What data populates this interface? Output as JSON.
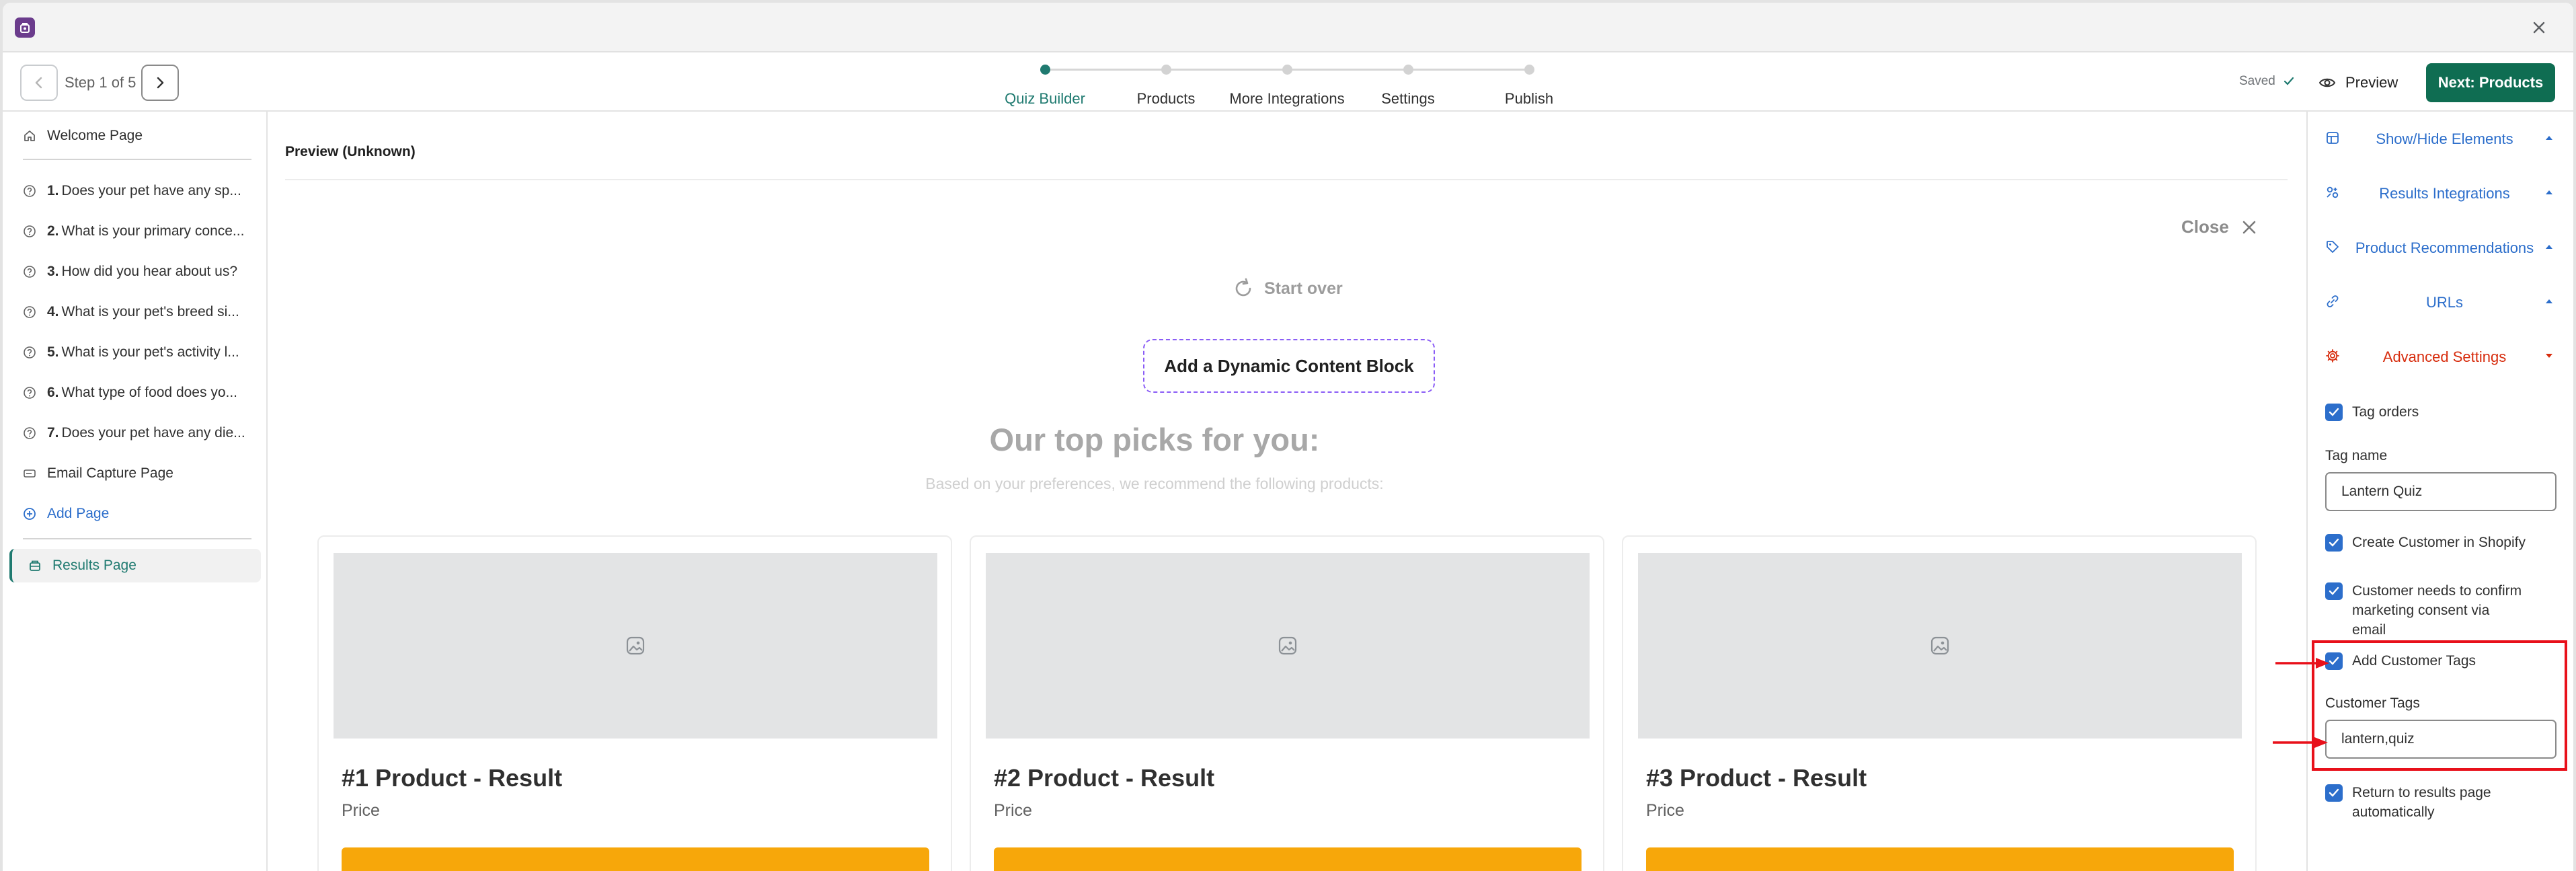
{
  "header": {
    "step_count": "Step 1 of 5",
    "steps": [
      {
        "label": "Quiz Builder",
        "active": true
      },
      {
        "label": "Products",
        "active": false
      },
      {
        "label": "More Integrations",
        "active": false
      },
      {
        "label": "Settings",
        "active": false
      },
      {
        "label": "Publish",
        "active": false
      }
    ],
    "saved": "Saved",
    "preview": "Preview",
    "next": "Next: Products"
  },
  "sidebar": {
    "welcome": "Welcome Page",
    "questions": [
      {
        "num": "1.",
        "text": "Does your pet have any sp..."
      },
      {
        "num": "2.",
        "text": "What is your primary conce..."
      },
      {
        "num": "3.",
        "text": "How did you hear about us?"
      },
      {
        "num": "4.",
        "text": "What is your pet's breed si..."
      },
      {
        "num": "5.",
        "text": "What is your pet's activity l..."
      },
      {
        "num": "6.",
        "text": "What type of food does yo..."
      },
      {
        "num": "7.",
        "text": "Does your pet have any die..."
      }
    ],
    "email_capture": "Email Capture Page",
    "add_page": "Add Page",
    "results": "Results Page"
  },
  "preview": {
    "title": "Preview (Unknown)",
    "close": "Close",
    "start_over": "Start over",
    "dynamic_block": "Add a Dynamic Content Block",
    "heading": "Our top picks for you:",
    "subheading": "Based on your preferences, we recommend the following products:",
    "products": [
      {
        "title": "#1 Product - Result",
        "price": "Price"
      },
      {
        "title": "#2 Product - Result",
        "price": "Price"
      },
      {
        "title": "#3 Product - Result",
        "price": "Price"
      }
    ]
  },
  "panel": {
    "sections": {
      "show_hide": "Show/Hide Elements",
      "results_integrations": "Results Integrations",
      "product_recommendations": "Product Recommendations",
      "urls": "URLs",
      "advanced": "Advanced Settings"
    },
    "tag_orders": "Tag orders",
    "tag_name_label": "Tag name",
    "tag_name_value": "Lantern Quiz",
    "create_customer": "Create Customer in Shopify",
    "confirm_consent": "Customer needs to confirm marketing consent via email",
    "add_customer_tags": "Add Customer Tags",
    "customer_tags_label": "Customer Tags",
    "customer_tags_value": "lantern,quiz",
    "return_results": "Return to results page automatically"
  },
  "colors": {
    "accent": "#1f7a70",
    "primary_button": "#0f6d52",
    "link": "#2c6ecb",
    "danger": "#d72c0d",
    "product_button": "#f7a70a",
    "annotation": "#e8101a"
  }
}
